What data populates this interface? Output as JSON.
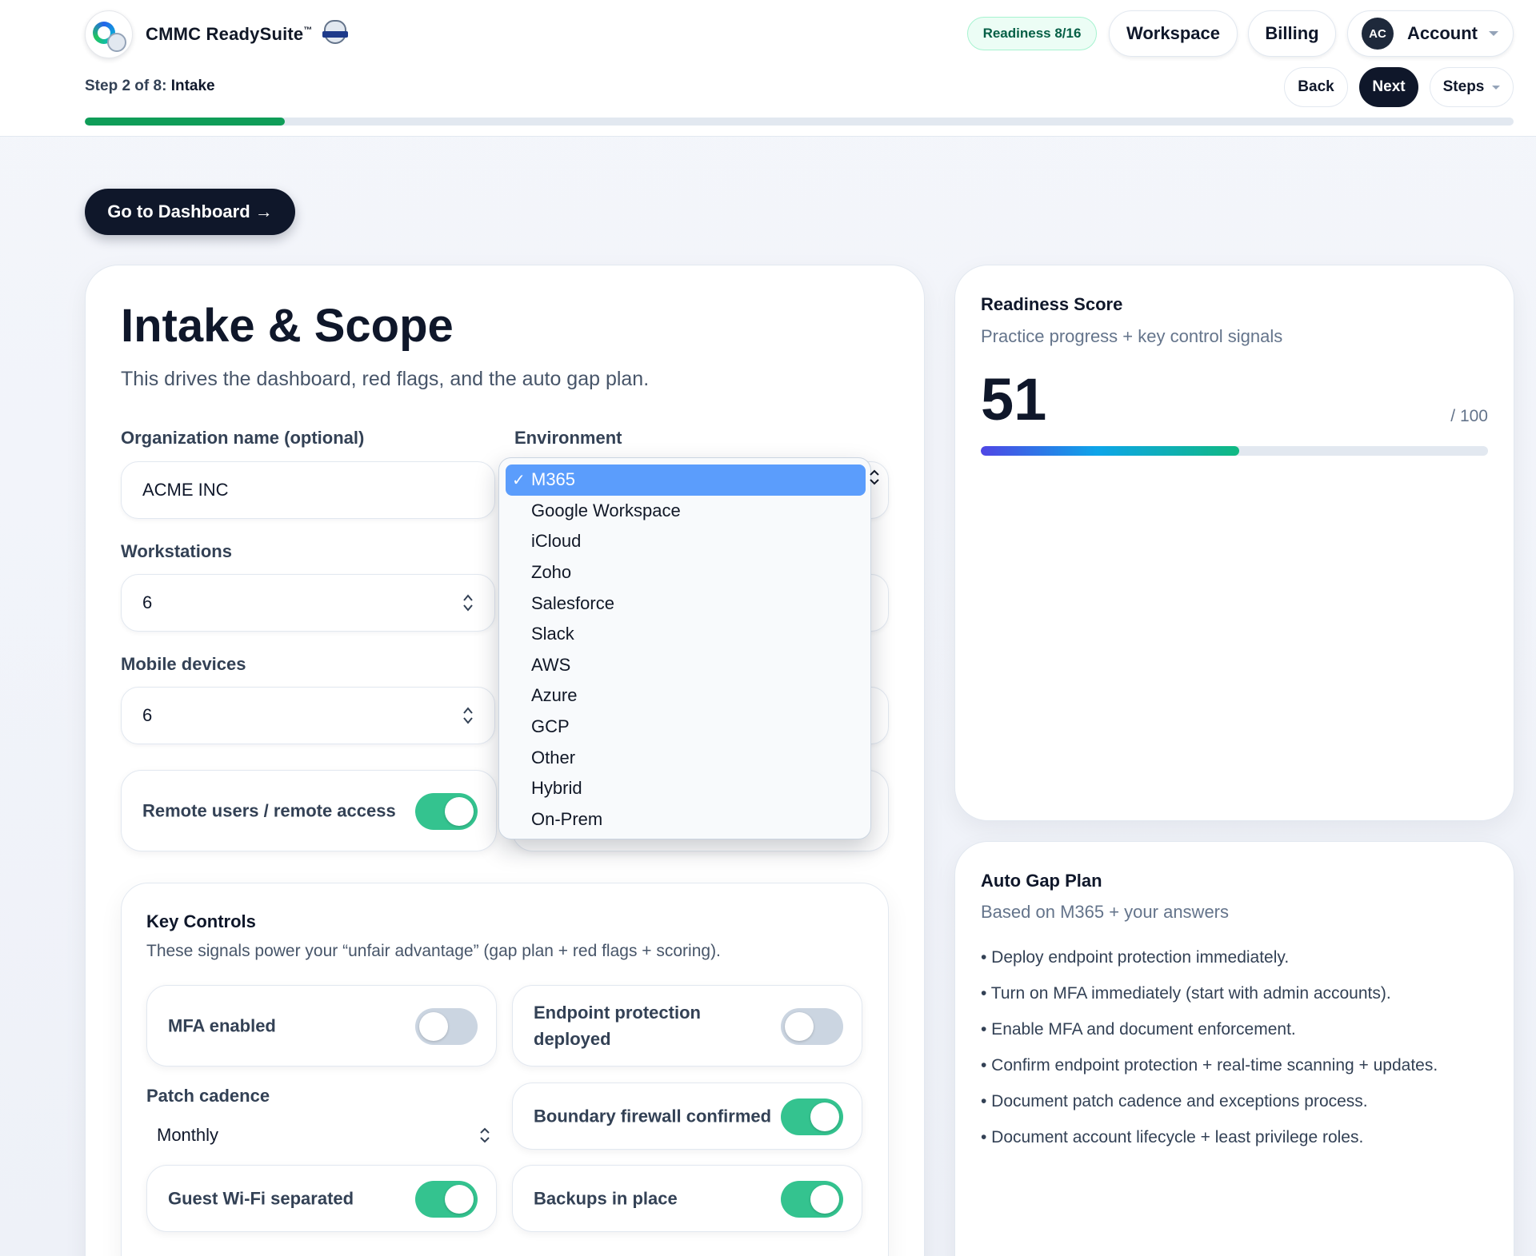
{
  "header": {
    "app_name": "CMMC ReadySuite",
    "trademark": "™",
    "readiness_badge": "Readiness 8/16",
    "workspace_label": "Workspace",
    "billing_label": "Billing",
    "avatar_initials": "AC",
    "account_label": "Account",
    "step_prefix": "Step 2 of 8:",
    "step_name": "Intake",
    "back_label": "Back",
    "next_label": "Next",
    "steps_label": "Steps",
    "progress_fraction": 0.14,
    "progress_color": "#0f9d58"
  },
  "main": {
    "dashboard_button": "Go to Dashboard →",
    "title": "Intake & Scope",
    "subtitle": "This drives the dashboard, red flags, and the auto gap plan.",
    "org_label": "Organization name (optional)",
    "org_value": "ACME INC",
    "environment_label": "Environment",
    "workstations_label": "Workstations",
    "workstations_value": "6",
    "mobile_label": "Mobile devices",
    "mobile_value": "6",
    "remote_label": "Remote users / remote access",
    "remote_on": true
  },
  "environment_dropdown": {
    "selected": "M365",
    "options": [
      "M365",
      "Google Workspace",
      "iCloud",
      "Zoho",
      "Salesforce",
      "Slack",
      "AWS",
      "Azure",
      "GCP",
      "Other",
      "Hybrid",
      "On-Prem"
    ],
    "selected_color": "#5b9dfc"
  },
  "key_controls": {
    "title": "Key Controls",
    "subtitle": "These signals power your “unfair advantage” (gap plan + red flags + scoring).",
    "mfa_label": "MFA enabled",
    "mfa_on": false,
    "endpoint_label_line1": "Endpoint protection",
    "endpoint_label_line2": "deployed",
    "endpoint_on": false,
    "patch_label": "Patch cadence",
    "patch_value": "Monthly",
    "firewall_label": "Boundary firewall confirmed",
    "firewall_on": true,
    "wifi_label": "Guest Wi-Fi separated",
    "wifi_on": true,
    "backups_label": "Backups in place",
    "backups_on": true,
    "toggle_on_color": "#34c38f",
    "toggle_off_color": "#cbd5e1"
  },
  "readiness": {
    "title": "Readiness Score",
    "subtitle": "Practice progress + key control signals",
    "score": "51",
    "max": "/ 100",
    "score_fraction": 0.51
  },
  "gap_plan": {
    "title": "Auto Gap Plan",
    "subtitle": "Based on M365 + your answers",
    "items": [
      "• Deploy endpoint protection immediately.",
      "• Turn on MFA immediately (start with admin accounts).",
      "• Enable MFA and document enforcement.",
      "• Confirm endpoint protection + real-time scanning + updates.",
      "• Document patch cadence and exceptions process.",
      "• Document account lifecycle + least privilege roles."
    ]
  }
}
